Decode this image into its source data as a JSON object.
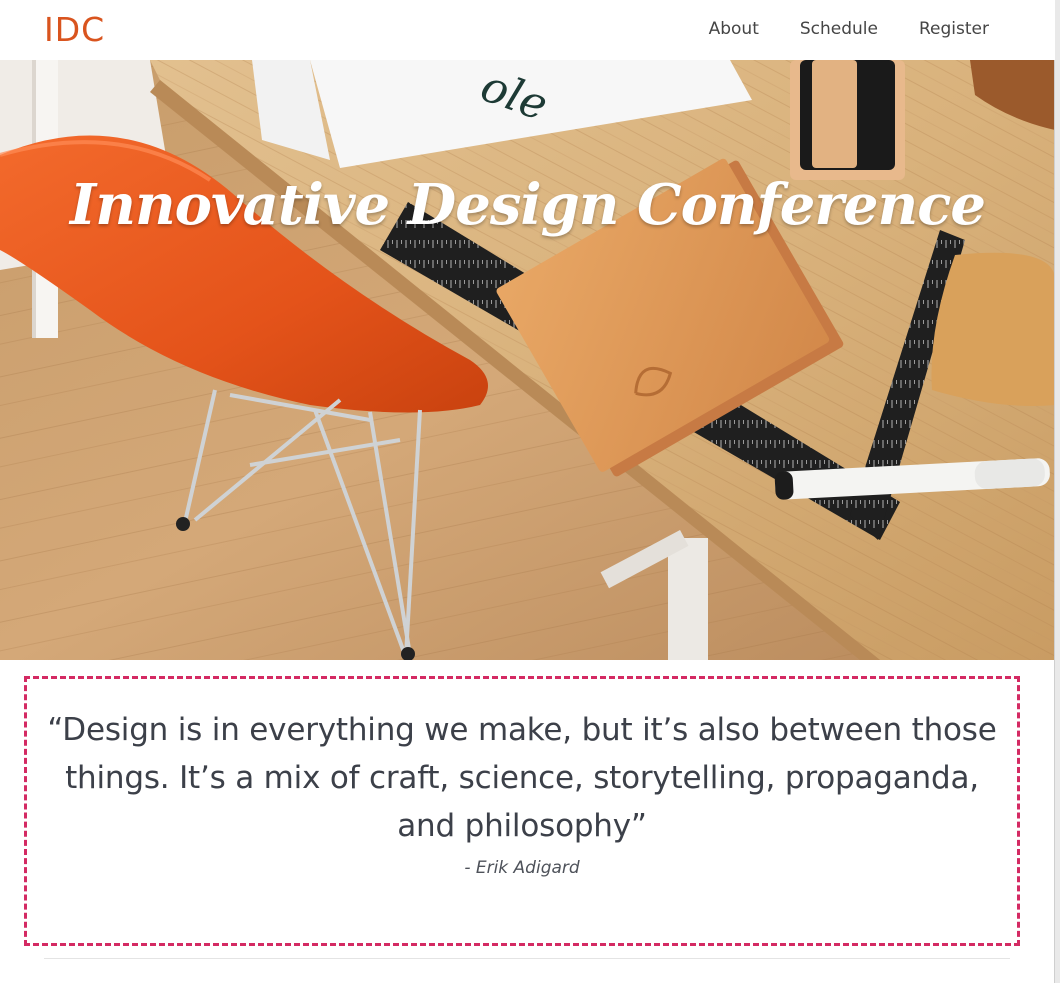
{
  "navbar": {
    "brand": "IDC",
    "links": [
      "About",
      "Schedule",
      "Register"
    ]
  },
  "hero": {
    "title": "Innovative Design Conference",
    "photo_subject": "wooden desk with orange chair, leather notebook, metal ruler and marker"
  },
  "quote": {
    "text": "“Design is in everything we make, but it’s also between those things. It’s a mix of craft, science, storytelling, propaganda, and philosophy”",
    "author": "- Erik Adigard"
  },
  "colors": {
    "brand": "#d9541e",
    "quote_border": "#d42a63",
    "text": "#3c4049"
  }
}
